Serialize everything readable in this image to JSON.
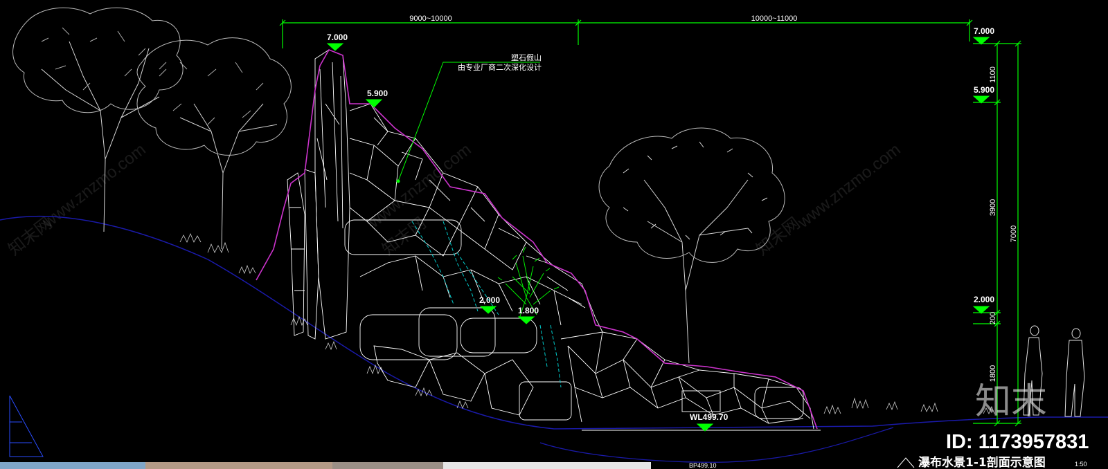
{
  "dimensions": {
    "top_left": "9000~10000",
    "top_right": "10000~11000",
    "right_1100": "1100",
    "right_3900": "3900",
    "right_200": "200",
    "right_1800": "1800",
    "right_total": "7000"
  },
  "elevations": {
    "peak": "7.000",
    "second_peak": "5.900",
    "ledge_a": "2.000",
    "ledge_b": "1.800",
    "water_level": "WL499.70",
    "right_top": "7.000",
    "right_5900": "5.900",
    "right_2000": "2.000"
  },
  "note": {
    "line1": "塑石假山",
    "line2": "由专业厂商二次深化设计"
  },
  "watermarks": {
    "site": "www.znzmo.com",
    "brand_cn": "知末网",
    "big_logo": "知末"
  },
  "footer": {
    "id_label": "ID: 1173957831",
    "drawing_title": "瀑布水景1-1剖面示意图",
    "scale": "1:50",
    "bottom_code": "BP499.10"
  },
  "colors": {
    "background": "#000000",
    "dim_line": "#00ff00",
    "rock_outline": "#ffffff",
    "rock_edge": "#cc33cc",
    "ground_line": "#1a1aaa",
    "water": "#00cccc",
    "marker": "#00ff00"
  }
}
